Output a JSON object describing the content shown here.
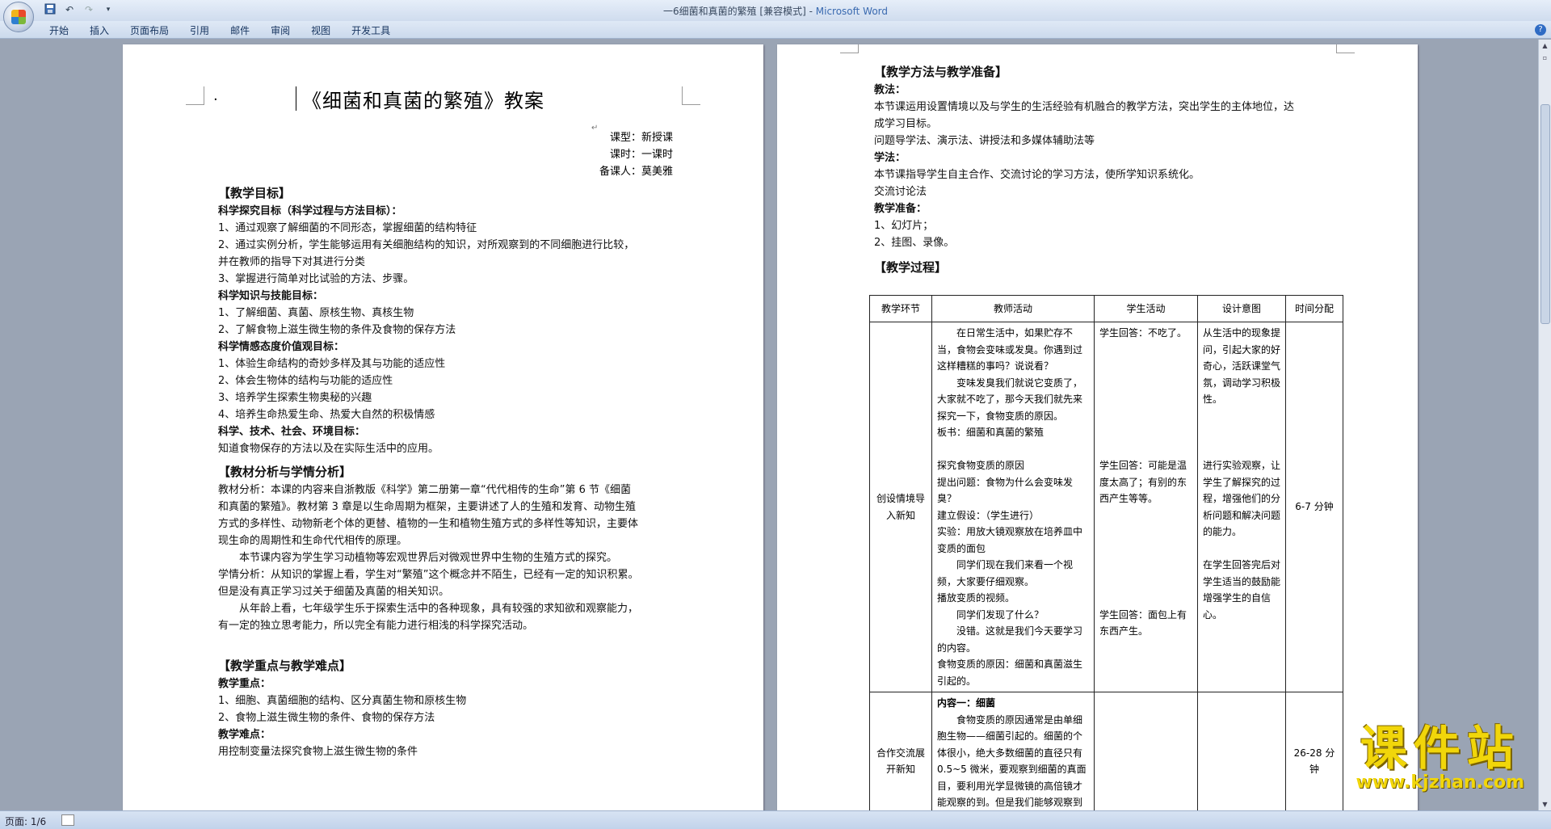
{
  "window": {
    "title": "一6细菌和真菌的繁殖 [兼容模式]",
    "app_separator": " - ",
    "app_name": "Microsoft Word"
  },
  "quick_access": {
    "save_icon": "save-icon",
    "undo_icon": "undo-icon",
    "redo_icon": "redo-icon",
    "more_icon": "customize-qat-icon"
  },
  "ribbon_tabs": [
    "开始",
    "插入",
    "页面布局",
    "引用",
    "邮件",
    "审阅",
    "视图",
    "开发工具"
  ],
  "page1": {
    "title": "《细菌和真菌的繁殖》教案",
    "meta": [
      "课型：新授课",
      "课时：一课时",
      "备课人：莫美雅"
    ],
    "sections": [
      {
        "heading": "【教学目标】",
        "lines": [
          {
            "text": "科学探究目标（科学过程与方法目标）：",
            "bold": true
          },
          {
            "text": "1、通过观察了解细菌的不同形态，掌握细菌的结构特征"
          },
          {
            "text": "2、通过实例分析，学生能够运用有关细胞结构的知识，对所观察到的不同细胞进行比较，"
          },
          {
            "text": "并在教师的指导下对其进行分类"
          },
          {
            "text": "3、掌握进行简单对比试验的方法、步骤。"
          },
          {
            "text": "科学知识与技能目标：",
            "bold": true
          },
          {
            "text": "1、了解细菌、真菌、原核生物、真核生物"
          },
          {
            "text": "2、了解食物上滋生微生物的条件及食物的保存方法"
          },
          {
            "text": "科学情感态度价值观目标：",
            "bold": true
          },
          {
            "text": "1、体验生命结构的奇妙多样及其与功能的适应性"
          },
          {
            "text": "2、体会生物体的结构与功能的适应性"
          },
          {
            "text": "3、培养学生探索生物奥秘的兴趣"
          },
          {
            "text": "4、培养生命热爱生命、热爱大自然的积极情感"
          },
          {
            "text": "科学、技术、社会、环境目标：",
            "bold": true
          },
          {
            "text": "知道食物保存的方法以及在实际生活中的应用。"
          }
        ]
      },
      {
        "heading": "【教材分析与学情分析】",
        "lines": [
          {
            "text": "教材分析：本课的内容来自浙教版《科学》第二册第一章“代代相传的生命”第 6 节《细菌"
          },
          {
            "text": "和真菌的繁殖》。教材第 3 章是以生命周期为框架，主要讲述了人的生殖和发育、动物生殖"
          },
          {
            "text": "方式的多样性、动物新老个体的更替、植物的一生和植物生殖方式的多样性等知识，主要体"
          },
          {
            "text": "现生命的周期性和生命代代相传的原理。"
          },
          {
            "text": "　　本节课内容为学生学习动植物等宏观世界后对微观世界中生物的生殖方式的探究。"
          },
          {
            "text": "学情分析：从知识的掌握上看，学生对“繁殖”这个概念并不陌生，已经有一定的知识积累。"
          },
          {
            "text": "但是没有真正学习过关于细菌及真菌的相关知识。"
          },
          {
            "text": "　　从年龄上看，七年级学生乐于探索生活中的各种现象，具有较强的求知欲和观察能力，"
          },
          {
            "text": "有一定的独立思考能力，所以完全有能力进行相浅的科学探究活动。"
          },
          {
            "text": ""
          }
        ]
      },
      {
        "heading": "【教学重点与教学难点】",
        "lines": [
          {
            "text": "教学重点：",
            "bold": true
          },
          {
            "text": "1、细胞、真菌细胞的结构、区分真菌生物和原核生物"
          },
          {
            "text": "2、食物上滋生微生物的条件、食物的保存方法"
          },
          {
            "text": "教学难点：",
            "bold": true
          },
          {
            "text": "用控制变量法探究食物上滋生微生物的条件"
          }
        ]
      }
    ]
  },
  "page2": {
    "heading1": "【教学方法与教学准备】",
    "lines": [
      {
        "text": "教法：",
        "bold": true
      },
      {
        "text": "本节课运用设置情境以及与学生的生活经验有机融合的教学方法，突出学生的主体地位，达"
      },
      {
        "text": "成学习目标。"
      },
      {
        "text": "问题导学法、演示法、讲授法和多媒体辅助法等"
      },
      {
        "text": "学法：",
        "bold": true
      },
      {
        "text": "本节课指导学生自主合作、交流讨论的学习方法，使所学知识系统化。"
      },
      {
        "text": "交流讨论法"
      },
      {
        "text": "教学准备：",
        "bold": true
      },
      {
        "text": "1、幻灯片；"
      },
      {
        "text": "2、挂图、录像。"
      }
    ],
    "heading2": "【教学过程】",
    "table": {
      "headers": [
        "教学环节",
        "教师活动",
        "学生活动",
        "设计意图",
        "时间分配"
      ],
      "rows": [
        {
          "stage": "创设情境导入新知",
          "teacher": [
            "　　在日常生活中，如果贮存不当，食物会变味或发臭。你遇到过这样糟糕的事吗？说说看？",
            "　　变味发臭我们就说它变质了，大家就不吃了，那今天我们就先来探究一下，食物变质的原因。",
            "板书：细菌和真菌的繁殖",
            "",
            "探究食物变质的原因",
            "提出问题：食物为什么会变味发臭？",
            "建立假设：（学生进行）",
            "实验：用放大镜观察放在培养皿中变质的面包",
            "　　同学们现在我们来看一个视频，大家要仔细观察。",
            "播放变质的视频。",
            "　　同学们发现了什么？",
            "　　没错。这就是我们今天要学习的内容。",
            "食物变质的原因：细菌和真菌滋生引起的。"
          ],
          "student": [
            "学生回答：不吃了。",
            "",
            "",
            "",
            "",
            "",
            "",
            "",
            "学生回答：可能是温度太高了；有别的东西产生等等。",
            "",
            "",
            "",
            "",
            "",
            "",
            "学生回答：面包上有东西产生。"
          ],
          "design": [
            "从生活中的现象提问，引起大家的好奇心，活跃课堂气氛，调动学习积极性。",
            "",
            "",
            "",
            "进行实验观察，让学生了解探究的过程，增强他们的分析问题和解决问题的能力。",
            "",
            "在学生回答完后对学生适当的鼓励能增强学生的自信心。"
          ],
          "time": "6-7 分钟"
        },
        {
          "stage": "合作交流展开新知",
          "teacher": [
            "内容一：细菌",
            "　　食物变质的原因通常是由单细胞生物——细菌引起的。细菌的个体很小，绝大多数细菌的直径只有 0.5~5 微米，要观察到细菌的真面目，要利用光学显微镜的高倍镜才能观察的到。但是我们能够观察到它们大量繁"
          ],
          "student": [
            "",
            "",
            "",
            "",
            "",
            "",
            "",
            ""
          ],
          "design": [
            "",
            "",
            "",
            "",
            "",
            "",
            "",
            ""
          ],
          "time": "26-28 分钟"
        }
      ]
    }
  },
  "statusbar": {
    "page": "页面: 1/6"
  },
  "watermark": {
    "title": "课件站",
    "url": "www.kjzhan.com"
  }
}
